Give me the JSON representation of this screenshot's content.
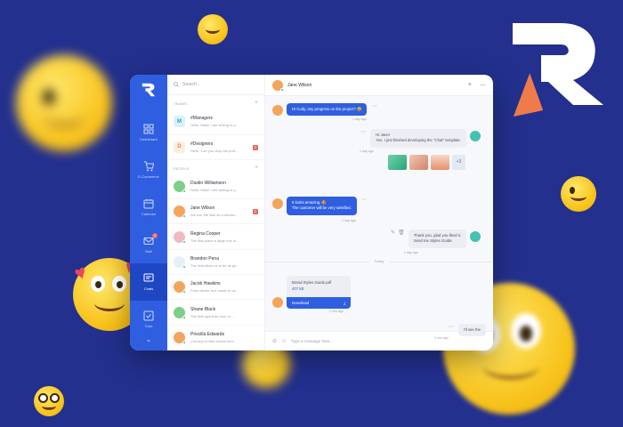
{
  "sidebar": {
    "items": [
      {
        "label": "Dashboard",
        "icon": "grid-icon"
      },
      {
        "label": "E-Commerce",
        "icon": "cart-icon"
      },
      {
        "label": "Calendar",
        "icon": "calendar-icon"
      },
      {
        "label": "Mail",
        "icon": "mail-icon",
        "badge": "3"
      },
      {
        "label": "Chats",
        "icon": "chat-icon",
        "active": true
      },
      {
        "label": "Todo",
        "icon": "checkbox-icon"
      }
    ]
  },
  "search": {
    "placeholder": "Search..."
  },
  "teams": {
    "title": "TEAMS",
    "items": [
      {
        "initial": "M",
        "name": "#Managers",
        "preview": "Hello, Mark! I am writing to y..."
      },
      {
        "initial": "D",
        "name": "#Designers",
        "preview": "Hello, Can you drop the prot...",
        "badge": "2"
      }
    ]
  },
  "people": {
    "title": "PEOPLE",
    "items": [
      {
        "name": "Dustin Williamson",
        "preview": "Hello, Mark! I am writing to y..."
      },
      {
        "name": "Jane Wilson",
        "preview": "We use the lists as a means...",
        "badge": "2"
      },
      {
        "name": "Regina Cooper",
        "preview": "The lists place a large role in..."
      },
      {
        "name": "Brandon Pena",
        "preview": "The lists allow us to be as ge..."
      },
      {
        "name": "Jacob Hawkins",
        "preview": "From dinner and music to ce..."
      },
      {
        "name": "Shane Black",
        "preview": "The lists spent an hour or ..."
      },
      {
        "name": "Priscilla Edwards",
        "preview": "Concept of lists shown thro..."
      }
    ]
  },
  "chat": {
    "contact": "Jane Wilson",
    "messages": {
      "m1": {
        "text": "Hi Cody, any progress on the project? 😃",
        "time": "1 day ago"
      },
      "m2": {
        "line1": "Hi Jane!",
        "line2": "Yes. I just finished developing the \"Chat\" template.",
        "time": "1 day ago"
      },
      "more_images": "+3",
      "m3": {
        "line1": "It looks amazing. 🤩",
        "line2": "The customer will be very satisfied.",
        "time": "1 day ago"
      },
      "m4": {
        "line1": "Thank you, glad you liked it.",
        "line2": "Send me Styles Guide.",
        "time": "1 day ago"
      },
      "today": "Today",
      "file": {
        "name": "Brand Styles Guide.pdf",
        "size": "407 kB",
        "button": "Download",
        "time": "2 min ago"
      },
      "m5": {
        "text": "I'll see the",
        "time": "2 min ago"
      }
    },
    "composer_placeholder": "Type a message here..."
  },
  "colors": {
    "background": "#23308d",
    "accent": "#2f5fe0",
    "badge": "#f06a5a",
    "logo_orange": "#f07b4a"
  }
}
